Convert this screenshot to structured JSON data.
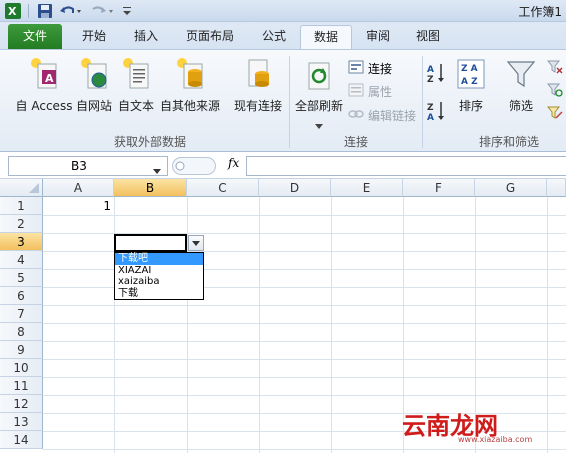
{
  "title_bar": {
    "title": "工作簿1"
  },
  "tabs": [
    {
      "label": "文件"
    },
    {
      "label": "开始"
    },
    {
      "label": "插入"
    },
    {
      "label": "页面布局"
    },
    {
      "label": "公式"
    },
    {
      "label": "数据"
    },
    {
      "label": "审阅"
    },
    {
      "label": "视图"
    }
  ],
  "ribbon": {
    "external": {
      "access": "自 Access",
      "web": "自网站",
      "text": "自文本",
      "other": "自其他来源",
      "existing": "现有连接",
      "group_label": "获取外部数据"
    },
    "connections": {
      "refresh_all": "全部刷新",
      "connections": "连接",
      "properties": "属性",
      "edit_links": "编辑链接",
      "group_label": "连接"
    },
    "sort_filter": {
      "sort": "排序",
      "filter": "筛选",
      "group_label": "排序和筛选"
    }
  },
  "formula_bar": {
    "name_box": "B3",
    "fx": "fx",
    "value": ""
  },
  "grid": {
    "columns": [
      "A",
      "B",
      "C",
      "D",
      "E",
      "F",
      "G"
    ],
    "rows": [
      "1",
      "2",
      "3",
      "4",
      "5",
      "6",
      "7",
      "8",
      "9",
      "10",
      "11",
      "12",
      "13",
      "14"
    ],
    "cells": {
      "A1": "1"
    },
    "selected": "B3"
  },
  "dropdown": {
    "options": [
      "下载吧",
      "XIAZAI",
      "xaizaiba",
      "下载"
    ],
    "highlighted_index": 0
  },
  "watermark": {
    "logo": "云南龙网",
    "url": "www.xiazaiba.com"
  },
  "colors": {
    "file_tab": "#2d8a2b",
    "selection_header": "#f3c05e",
    "highlight": "#3399ff",
    "watermark": "#d01b1b"
  }
}
